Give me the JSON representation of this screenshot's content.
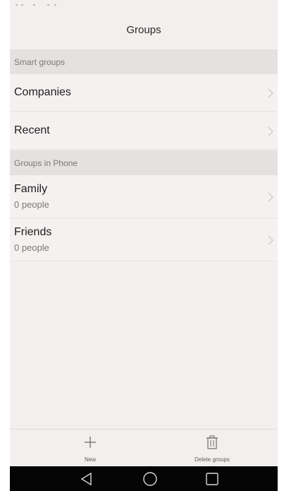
{
  "header": {
    "title": "Groups"
  },
  "sections": {
    "smart": {
      "label": "Smart groups",
      "items": [
        {
          "label": "Companies"
        },
        {
          "label": "Recent"
        }
      ]
    },
    "phone": {
      "label": "Groups in Phone",
      "items": [
        {
          "label": "Family",
          "count": "0 people"
        },
        {
          "label": "Friends",
          "count": "0 people"
        }
      ]
    }
  },
  "toolbar": {
    "new_label": "New",
    "delete_label": "Delete groups"
  },
  "icons": {
    "chevron": "chevron-right-icon",
    "new": "plus-icon",
    "delete": "trash-icon",
    "nav_back": "triangle-back-icon",
    "nav_home": "circle-home-icon",
    "nav_recents": "square-recents-icon"
  },
  "colors": {
    "background": "#f2efee",
    "section_header": "#e4e1e0",
    "nav_bar": "#050505"
  }
}
